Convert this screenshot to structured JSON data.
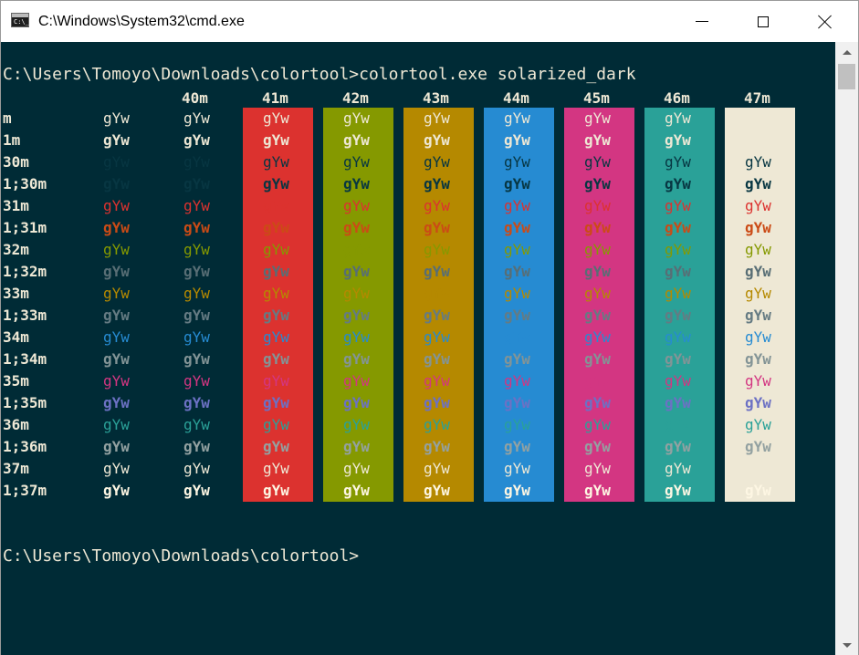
{
  "window": {
    "title": "C:\\Windows\\System32\\cmd.exe",
    "icon": "cmd-icon",
    "icon_prompt": "C:\\_"
  },
  "controls": {
    "minimize_icon": "minimize-icon",
    "maximize_icon": "maximize-icon",
    "close_icon": "close-icon"
  },
  "console": {
    "command_line": "C:\\Users\\Tomoyo\\Downloads\\colortool>colortool.exe solarized_dark",
    "final_prompt": "C:\\Users\\Tomoyo\\Downloads\\colortool>",
    "sample_text": "gYw",
    "column_headers": [
      "40m",
      "41m",
      "42m",
      "43m",
      "44m",
      "45m",
      "46m",
      "47m"
    ],
    "row_labels": [
      "m",
      "1m",
      "30m",
      "1;30m",
      "31m",
      "1;31m",
      "32m",
      "1;32m",
      "33m",
      "1;33m",
      "34m",
      "1;34m",
      "35m",
      "1;35m",
      "36m",
      "1;36m",
      "37m",
      "1;37m"
    ]
  },
  "palette": {
    "default_bg": "#002b36",
    "default_fg": "#eee8d5",
    "backgrounds": [
      "#002b36",
      "#dc322f",
      "#859900",
      "#b58900",
      "#268bd2",
      "#d33682",
      "#2aa198",
      "#eee8d5"
    ],
    "foregrounds": [
      "#eee8d5",
      "#eee8d5",
      "#073642",
      "#073642",
      "#dc322f",
      "#cb4b16",
      "#859900",
      "#586e75",
      "#b58900",
      "#657b83",
      "#268bd2",
      "#839496",
      "#d33682",
      "#6c71c4",
      "#2aa198",
      "#93a1a1",
      "#eee8d5",
      "#fdf6e3"
    ]
  }
}
